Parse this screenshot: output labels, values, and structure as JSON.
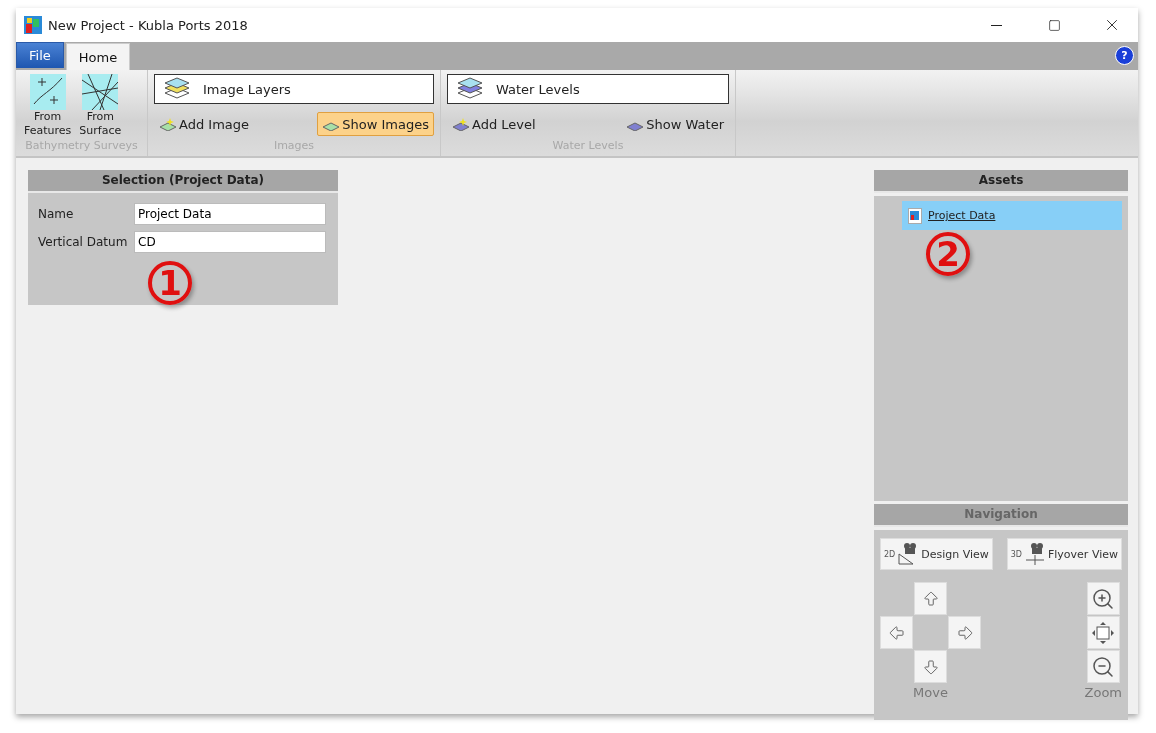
{
  "window": {
    "title": "New Project - Kubla Ports 2018"
  },
  "ribbon": {
    "tabs": [
      {
        "label": "File",
        "kind": "file",
        "selected": false
      },
      {
        "label": "Home",
        "kind": "tab",
        "selected": true
      }
    ],
    "help": "?",
    "groups": [
      {
        "label": "Bathymetry Surveys",
        "kind": "large",
        "buttons": [
          {
            "lines": [
              "From",
              "Features"
            ]
          },
          {
            "lines": [
              "From",
              "Surface"
            ]
          }
        ]
      },
      {
        "label": "Images",
        "kind": "list",
        "dropdown": "Image Layers",
        "buttons": [
          {
            "label": "Add Image",
            "selected": false
          },
          {
            "label": "Show Images",
            "selected": true
          }
        ]
      },
      {
        "label": "Water Levels",
        "kind": "list",
        "dropdown": "Water Levels",
        "buttons": [
          {
            "label": "Add Level",
            "selected": false
          },
          {
            "label": "Show Water",
            "selected": false
          }
        ]
      }
    ]
  },
  "selection": {
    "title": "Selection (Project Data)",
    "fields": [
      {
        "label": "Name",
        "value": "Project Data"
      },
      {
        "label": "Vertical Datum",
        "value": "CD"
      }
    ],
    "callout": "1"
  },
  "assets": {
    "title": "Assets",
    "items": [
      {
        "label": "Project Data",
        "selected": true
      }
    ],
    "callout": "2"
  },
  "navigation": {
    "title": "Navigation",
    "views": [
      {
        "label": "Design View",
        "badge": "2D"
      },
      {
        "label": "Flyover View",
        "badge": "3D"
      }
    ],
    "move_label": "Move",
    "zoom_label": "Zoom"
  }
}
